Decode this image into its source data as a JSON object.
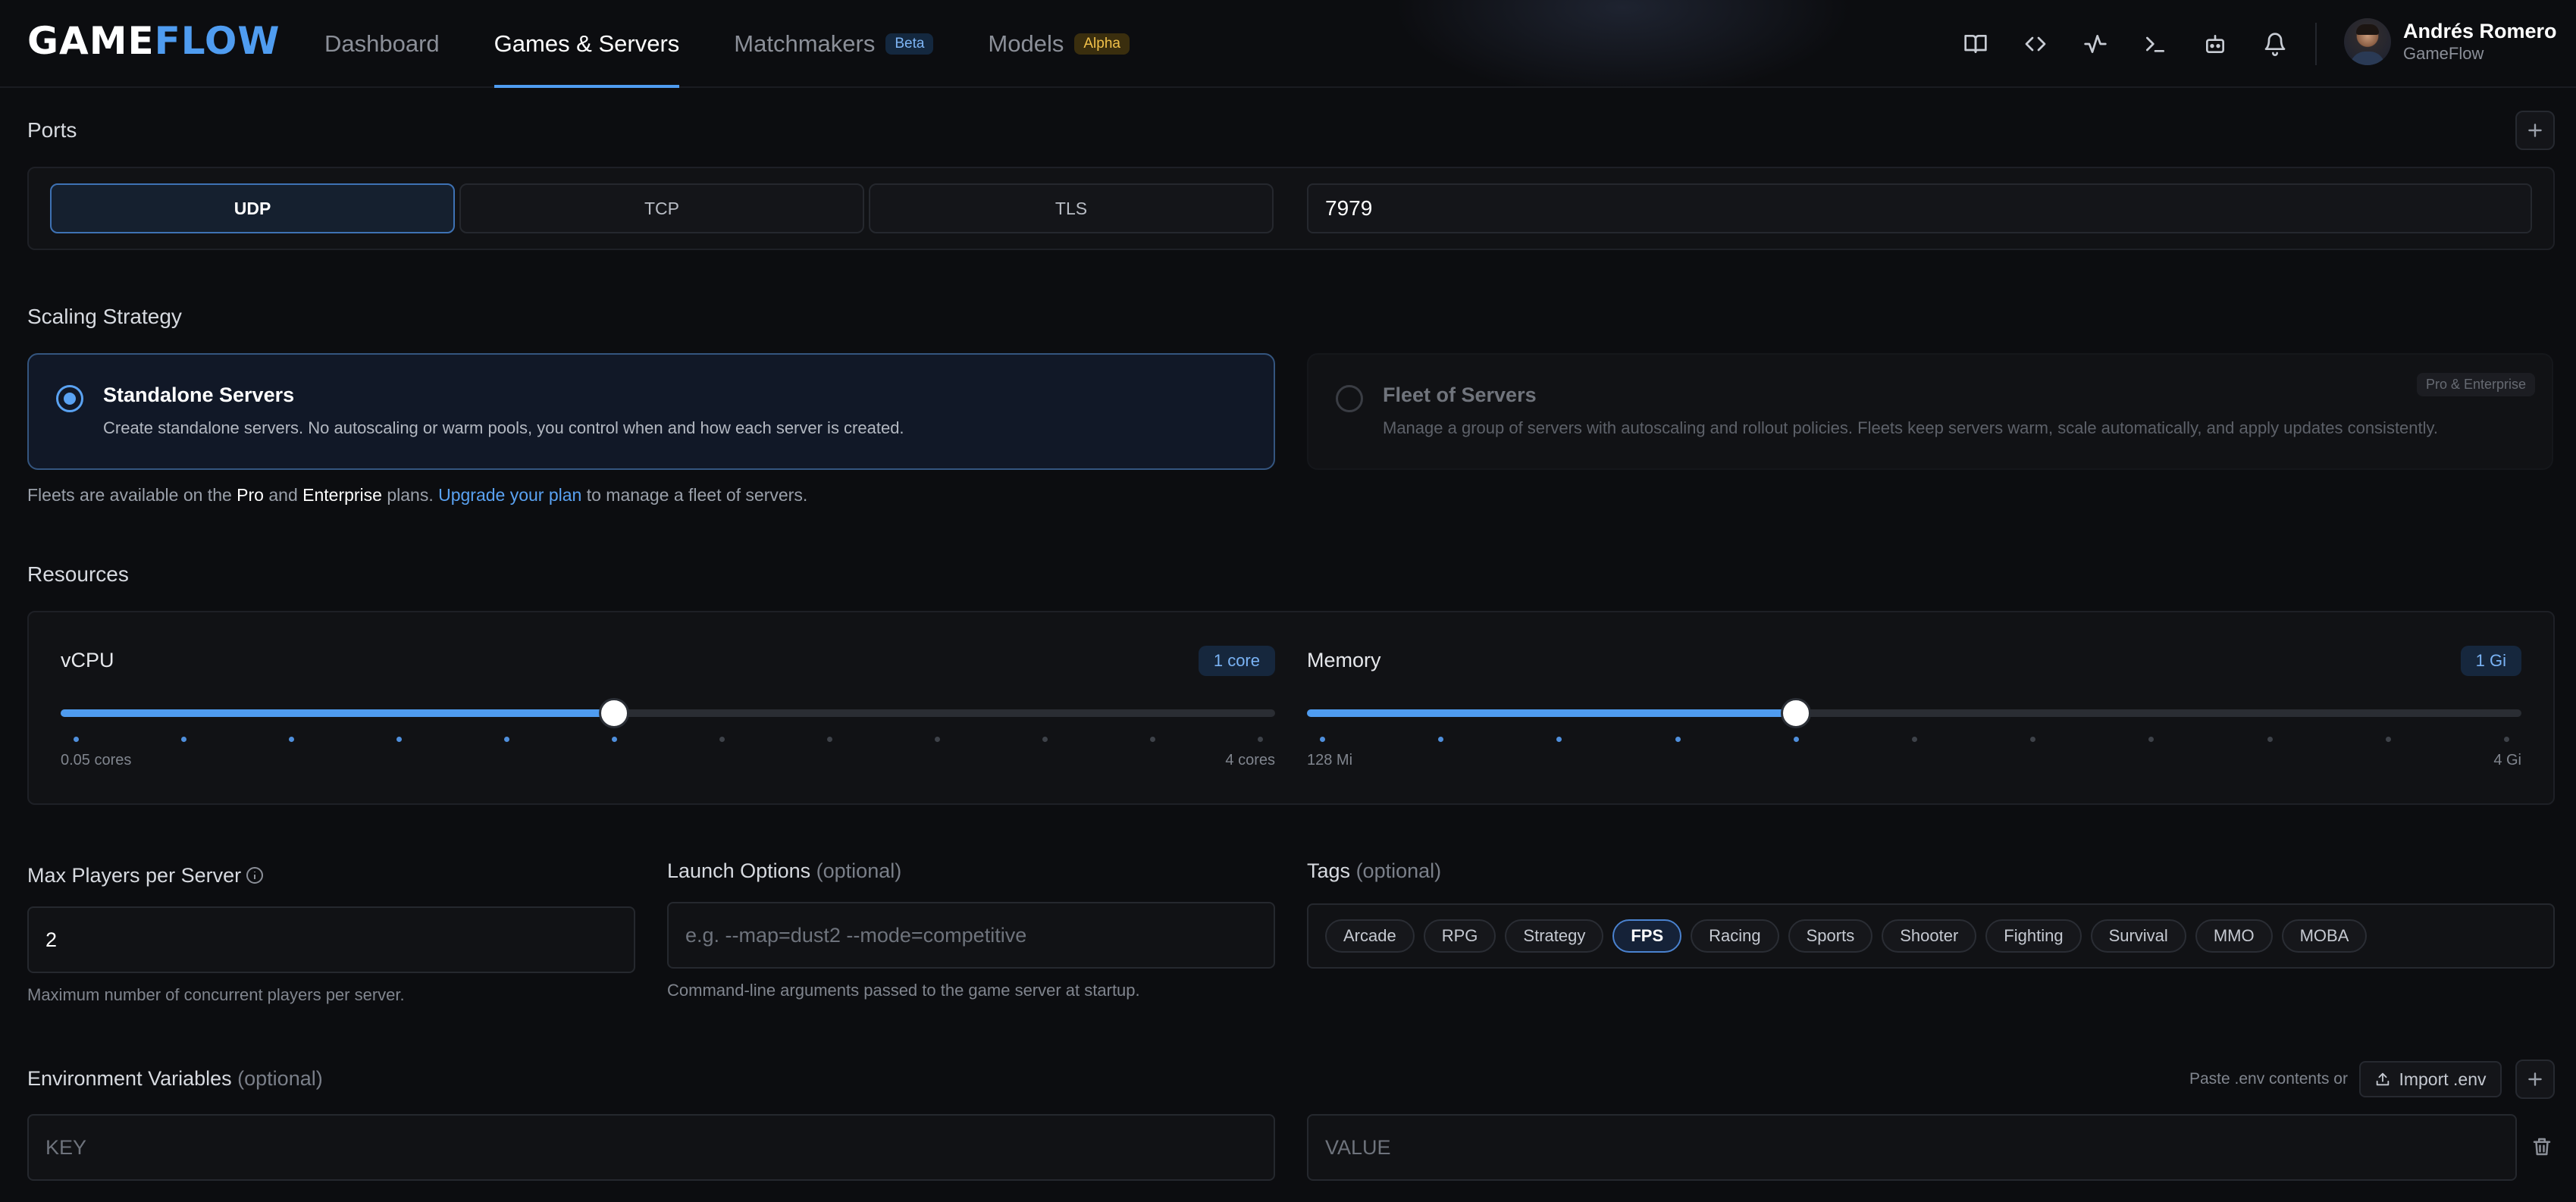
{
  "header": {
    "logo_part1": "GAME",
    "logo_part2": "FLOW",
    "nav": [
      {
        "label": "Dashboard",
        "active": false
      },
      {
        "label": "Games & Servers",
        "active": true
      },
      {
        "label": "Matchmakers",
        "badge": "Beta"
      },
      {
        "label": "Models",
        "badge": "Alpha"
      }
    ],
    "icons": [
      "book-icon",
      "code-icon",
      "activity-icon",
      "terminal-icon",
      "bot-icon",
      "bell-icon"
    ],
    "user": {
      "name": "Andrés Romero",
      "org": "GameFlow"
    }
  },
  "ports": {
    "title": "Ports",
    "protocols": [
      "UDP",
      "TCP",
      "TLS"
    ],
    "selected": "UDP",
    "port_value": "7979"
  },
  "scaling": {
    "title": "Scaling Strategy",
    "options": [
      {
        "title": "Standalone Servers",
        "description": "Create standalone servers. No autoscaling or warm pools, you control when and how each server is created.",
        "selected": true
      },
      {
        "title": "Fleet of Servers",
        "description": "Manage a group of servers with autoscaling and rollout policies. Fleets keep servers warm, scale automatically, and apply updates consistently.",
        "badge": "Pro & Enterprise",
        "disabled": true
      }
    ],
    "note": {
      "prefix": "Fleets are available on the ",
      "pro": "Pro",
      "and": " and ",
      "enterprise": "Enterprise",
      "plans": " plans. ",
      "link": "Upgrade your plan",
      "suffix": " to manage a fleet of servers."
    }
  },
  "resources": {
    "title": "Resources",
    "vcpu": {
      "label": "vCPU",
      "value_label": "1 core",
      "min_label": "0.05 cores",
      "max_label": "4 cores",
      "steps": 12,
      "selected_step": 5
    },
    "memory": {
      "label": "Memory",
      "value_label": "1 Gi",
      "min_label": "128 Mi",
      "max_label": "4 Gi",
      "steps": 11,
      "selected_step": 4
    }
  },
  "max_players": {
    "label": "Max Players per Server",
    "value": "2",
    "help": "Maximum number of concurrent players per server."
  },
  "launch_options": {
    "label": "Launch Options",
    "optional": "(optional)",
    "placeholder": "e.g. --map=dust2 --mode=competitive",
    "help": "Command-line arguments passed to the game server at startup."
  },
  "tags": {
    "label": "Tags",
    "optional": "(optional)",
    "items": [
      "Arcade",
      "RPG",
      "Strategy",
      "FPS",
      "Racing",
      "Sports",
      "Shooter",
      "Fighting",
      "Survival",
      "MMO",
      "MOBA"
    ],
    "selected": "FPS"
  },
  "env": {
    "label": "Environment Variables",
    "optional": "(optional)",
    "paste_text": "Paste .env contents or",
    "import_label": "Import .env",
    "key_placeholder": "KEY",
    "value_placeholder": "VALUE"
  },
  "colors": {
    "accent": "#4f9cf0",
    "background": "#0c0d10",
    "beta": "#7eb5f5",
    "alpha": "#f1c14a"
  }
}
